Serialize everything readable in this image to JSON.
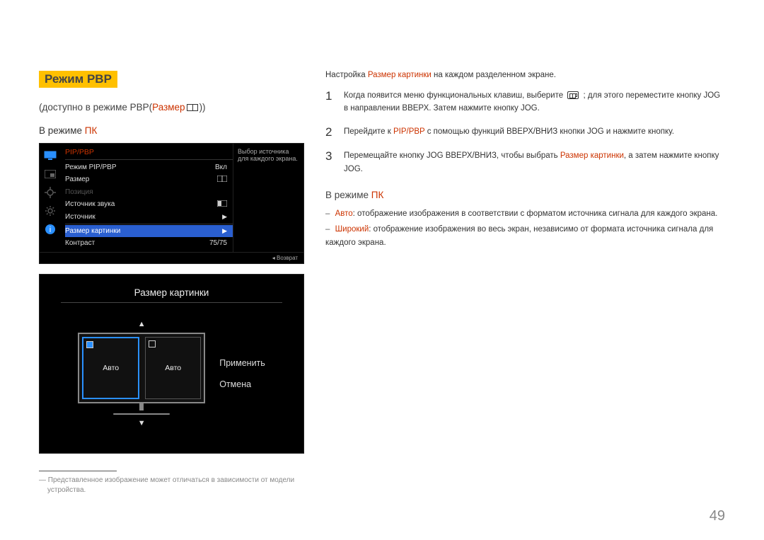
{
  "title": "Режим PBP",
  "subtitle_prefix": "(доступно в режиме PBP(",
  "subtitle_red": "Размер",
  "subtitle_suffix": "))",
  "mode_prefix": "В режиме ",
  "mode_red": "ПК",
  "osd": {
    "header": "PIP/PBP",
    "rows": {
      "mode_label": "Режим PIP/PBP",
      "mode_value": "Вкл",
      "size_label": "Размер",
      "position_label": "Позиция",
      "sound_label": "Источник звука",
      "source_label": "Источник",
      "picsize_label": "Размер картинки",
      "contrast_label": "Контраст",
      "contrast_value": "75/75"
    },
    "side_text": "Выбор источника для каждого экрана.",
    "footer": "Возврат"
  },
  "preview": {
    "title": "Размер картинки",
    "option_a": "Авто",
    "option_b": "Авто",
    "apply": "Применить",
    "cancel": "Отмена"
  },
  "note_line1": "Представленное изображение может отличаться в зависимости от модели",
  "note_line2": "устройства.",
  "right": {
    "intro_prefix": "Настройка ",
    "intro_red": "Размер картинки",
    "intro_suffix": " на каждом разделенном экране.",
    "step1_a": "Когда появится меню функциональных клавиш, выберите ",
    "step1_b": " ; для этого переместите кнопку JOG в направлении ВВЕРХ. Затем нажмите кнопку JOG.",
    "step2_a": "Перейдите к ",
    "step2_red": "PIP/PBP",
    "step2_b": " с помощью функций ВВЕРХ/ВНИЗ кнопки JOG и нажмите кнопку.",
    "step3_a": "Перемещайте кнопку JOG ВВЕРХ/ВНИЗ, чтобы выбрать ",
    "step3_red": "Размер картинки",
    "step3_b": ", а затем нажмите кнопку JOG.",
    "mode_prefix": "В режиме ",
    "mode_red": "ПК",
    "b1_dash": "–",
    "b1_red": "Авто",
    "b1_text": ": отображение изображения в соответствии с форматом источника сигнала для каждого экрана.",
    "b2_dash": "–",
    "b2_red": "Широкий",
    "b2_text": ": отображение изображения во весь экран, независимо от формата источника сигнала для каждого экрана."
  },
  "page_number": "49"
}
